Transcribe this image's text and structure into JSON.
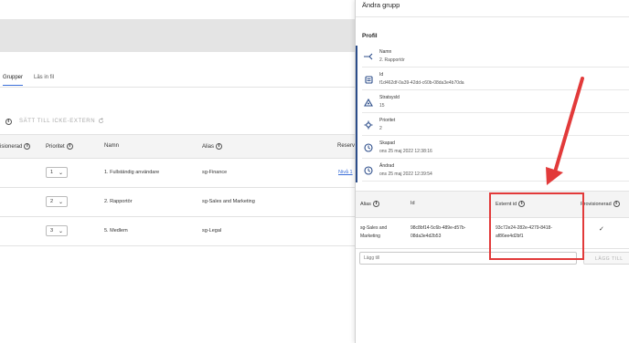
{
  "background": {
    "tabs": [
      "Grupper",
      "Läs in fil"
    ],
    "toolbar_action": "SÄTT TILL ICKE-EXTERN",
    "table_headers": {
      "provisioned": "isionerad",
      "priority": "Prioritet",
      "name": "Namn",
      "alias": "Alias",
      "reserved": "Reserve"
    },
    "rows": [
      {
        "priority": "1",
        "name": "1. Fullständig användare",
        "alias": "sg-Finance",
        "link": "Nivå 1"
      },
      {
        "priority": "2",
        "name": "2. Rapportör",
        "alias": "sg-Sales and Marketing",
        "link": ""
      },
      {
        "priority": "3",
        "name": "5. Medlem",
        "alias": "sg-Legal",
        "link": ""
      }
    ]
  },
  "drawer": {
    "title": "Ändra grupp",
    "profile_title": "Profil",
    "properties": [
      {
        "icon": "arrows-icon",
        "label": "Namn",
        "value": "2. Rapportör"
      },
      {
        "icon": "id-card-icon",
        "label": "Id",
        "value": "f1d462df-0a39-42dd-c60b-08da3e4b70da"
      },
      {
        "icon": "hierarchy-icon",
        "label": "Stratsysld",
        "value": "15"
      },
      {
        "icon": "priority-icon",
        "label": "Prioritet",
        "value": "2"
      },
      {
        "icon": "clock-icon",
        "label": "Skapad",
        "value": "ons 25 maj 2022 12:38:16"
      },
      {
        "icon": "clock-icon",
        "label": "Ändrad",
        "value": "ons 25 maj 2022 12:39:54"
      }
    ],
    "table_headers": {
      "alias": "Alias",
      "id": "Id",
      "external_id": "Externt id",
      "provisioned": "Provisionerad"
    },
    "row": {
      "alias_line1": "sg-Sales and",
      "alias_line2": "Marketing",
      "id_line1": "98c8bf14-5c6b-489e-d57b-",
      "id_line2": "08da3e4d2b53",
      "external_id_line1": "93c72e24-282e-4279-8418-",
      "external_id_line2": "af86ee4d2bf1",
      "provisioned_mark": "✓"
    },
    "add_placeholder": "Lägg till",
    "add_button": "LÄGG TILL"
  },
  "colors": {
    "accent": "#3b6fd8",
    "profile_bar": "#2c4d8a",
    "annotation": "#e23a3a"
  }
}
